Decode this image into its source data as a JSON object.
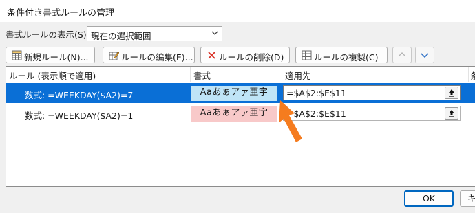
{
  "window": {
    "title": "条件付き書式ルールの管理"
  },
  "filter": {
    "label": "書式ルールの表示(S):",
    "value": "現在の選択範囲"
  },
  "toolbar": {
    "new_rule": "新規ルール(N)...",
    "edit_rule": "ルールの編集(E)...",
    "delete_rule": "ルールの削除(D)",
    "duplicate_rule": "ルールの複製(C)"
  },
  "columns": {
    "rule": "ルール (表示順で適用)",
    "format": "書式",
    "applies_to": "適用先",
    "stop_if_true": "条"
  },
  "rules": [
    {
      "rule": "数式: =WEEKDAY($A2)=7",
      "preview": "Aaあぁアァ亜宇",
      "applies_to": "=$A$2:$E$11",
      "selected": true
    },
    {
      "rule": "数式: =WEEKDAY($A2)=1",
      "preview": "Aaあぁアァ亜宇",
      "applies_to": "=$A$2:$E$11",
      "selected": false
    }
  ],
  "buttons": {
    "ok": "OK",
    "cancel": "キ"
  },
  "colors": {
    "selection": "#0a6fd6",
    "saturday_fill": "#bfe4f7",
    "sunday_fill": "#f8c9c9",
    "annotation_arrow": "#f57c1f"
  },
  "icons": [
    "new-rule-icon",
    "edit-rule-icon",
    "delete-x-icon",
    "duplicate-rule-icon",
    "move-up-icon",
    "move-down-icon",
    "chevron-down-icon",
    "collapse-range-icon",
    "orange-pointer-arrow"
  ]
}
